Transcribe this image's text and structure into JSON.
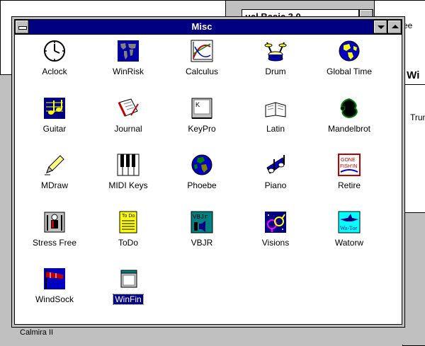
{
  "window": {
    "title": "Misc"
  },
  "background": {
    "mid_title": "ual Basic 3.0",
    "tree_label": "ree",
    "wi_label": "t Wi",
    "tru_label": "Trum",
    "calmira_label": "Calmira II"
  },
  "icons": [
    {
      "label": "Aclock",
      "icon": "clock-icon"
    },
    {
      "label": "WinRisk",
      "icon": "world-map-icon"
    },
    {
      "label": "Calculus",
      "icon": "graph-icon"
    },
    {
      "label": "Drum",
      "icon": "drum-icon"
    },
    {
      "label": "Global Time",
      "icon": "globe-icon"
    },
    {
      "label": "Guitar",
      "icon": "music-note-icon"
    },
    {
      "label": "Journal",
      "icon": "notebook-icon"
    },
    {
      "label": "KeyPro",
      "icon": "key-icon"
    },
    {
      "label": "Latin",
      "icon": "open-book-icon"
    },
    {
      "label": "Mandelbrot",
      "icon": "fractal-icon"
    },
    {
      "label": "MDraw",
      "icon": "pencil-icon"
    },
    {
      "label": "MIDI Keys",
      "icon": "piano-keys-icon"
    },
    {
      "label": "Phoebe",
      "icon": "earth-icon"
    },
    {
      "label": "Piano",
      "icon": "piano-note-icon"
    },
    {
      "label": "Retire",
      "icon": "gone-fishin-icon"
    },
    {
      "label": "Stress Free",
      "icon": "meditation-icon"
    },
    {
      "label": "ToDo",
      "icon": "todo-list-icon"
    },
    {
      "label": "VBJR",
      "icon": "vbjr-icon"
    },
    {
      "label": "Visions",
      "icon": "gender-symbols-icon"
    },
    {
      "label": "Watorw",
      "icon": "shark-icon"
    },
    {
      "label": "WindSock",
      "icon": "windsock-icon"
    },
    {
      "label": "WinFin",
      "icon": "window-folder-icon",
      "selected": true
    }
  ],
  "colors": {
    "titlebar": "#000080",
    "selection": "#000080",
    "desktop": "#c0c0c0"
  }
}
